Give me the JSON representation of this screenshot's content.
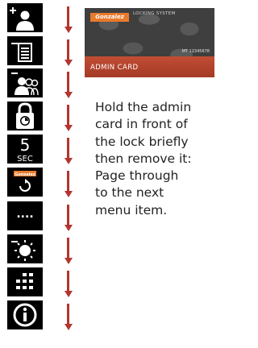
{
  "steps": [
    {
      "icon": "add-user-icon"
    },
    {
      "icon": "list-document-icon"
    },
    {
      "icon": "remove-users-icon"
    },
    {
      "icon": "lock-timer-icon"
    },
    {
      "icon": "five-seconds-icon",
      "digit": "5",
      "unit": "SEC"
    },
    {
      "icon": "rotate-card-icon"
    },
    {
      "icon": "code-dots-icon",
      "dots": "...."
    },
    {
      "icon": "brightness-icon"
    },
    {
      "icon": "keypad-grid-icon"
    },
    {
      "icon": "info-icon"
    }
  ],
  "card": {
    "logo": "Gonzalez",
    "brand": "LOCKING SYSTEM",
    "serial": "MT 12345678",
    "label": "ADMIN CARD"
  },
  "description": "Hold the admin\ncard in front of\nthe lock briefly\nthen remove it:\nPage through\nto the next\nmenu item.",
  "colors": {
    "arrow": "#b3352f",
    "card_band": "#b5432c",
    "logo": "#e87a2c"
  }
}
